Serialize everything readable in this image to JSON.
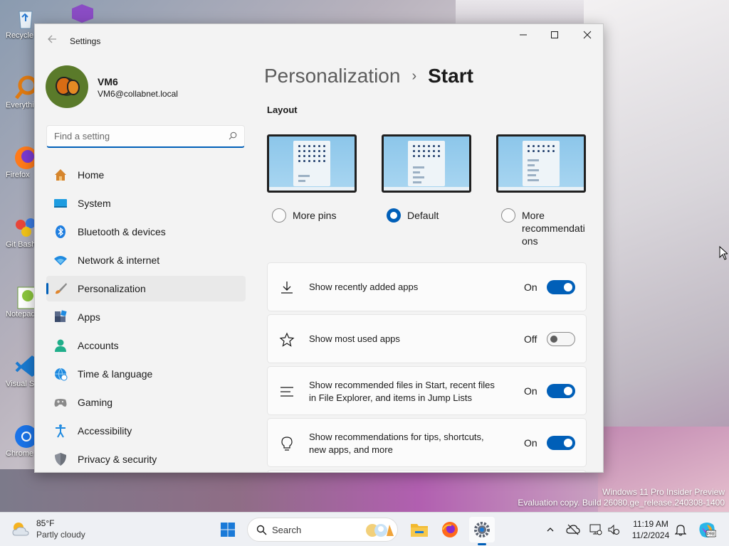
{
  "desktop": {
    "icons": [
      {
        "label": "Recycle Bin",
        "icon": "recycle-bin-icon"
      },
      {
        "label": "Everything",
        "icon": "everything-search-icon"
      },
      {
        "label": "Firefox",
        "icon": "firefox-icon"
      },
      {
        "label": "Git Bash",
        "icon": "git-bash-icon"
      },
      {
        "label": "Notepad++",
        "icon": "notepad-plus-plus-icon"
      },
      {
        "label": "Visual Studio Code",
        "icon": "vscode-icon"
      },
      {
        "label": "Chrome",
        "icon": "chrome-icon"
      }
    ],
    "watermark_line1": "Windows 11 Pro Insider Preview",
    "watermark_line2": "Evaluation copy. Build 26080.ge_release.240308-1400"
  },
  "window": {
    "title": "Settings",
    "controls": {
      "minimize": "—",
      "maximize": "☐",
      "close": "✕"
    }
  },
  "profile": {
    "name": "VM6",
    "email": "VM6@collabnet.local"
  },
  "search": {
    "placeholder": "Find a setting"
  },
  "sidebar": {
    "items": [
      {
        "label": "Home",
        "icon": "home-icon",
        "active": false
      },
      {
        "label": "System",
        "icon": "system-icon",
        "active": false
      },
      {
        "label": "Bluetooth & devices",
        "icon": "bluetooth-icon",
        "active": false
      },
      {
        "label": "Network & internet",
        "icon": "network-icon",
        "active": false
      },
      {
        "label": "Personalization",
        "icon": "brush-icon",
        "active": true
      },
      {
        "label": "Apps",
        "icon": "apps-icon",
        "active": false
      },
      {
        "label": "Accounts",
        "icon": "accounts-icon",
        "active": false
      },
      {
        "label": "Time & language",
        "icon": "time-language-icon",
        "active": false
      },
      {
        "label": "Gaming",
        "icon": "gaming-icon",
        "active": false
      },
      {
        "label": "Accessibility",
        "icon": "accessibility-icon",
        "active": false
      },
      {
        "label": "Privacy & security",
        "icon": "shield-icon",
        "active": false
      }
    ]
  },
  "main": {
    "breadcrumb_parent": "Personalization",
    "breadcrumb_sep": "›",
    "breadcrumb_current": "Start",
    "layout_section_title": "Layout",
    "layout_options": [
      {
        "label": "More pins",
        "selected": false
      },
      {
        "label": "Default",
        "selected": true
      },
      {
        "label_line1": "More",
        "label_line2": "recommendati",
        "label_line3": "ons",
        "selected": false
      }
    ],
    "settings": [
      {
        "label": "Show recently added apps",
        "state": "On",
        "on": true,
        "icon": "download-icon"
      },
      {
        "label": "Show most used apps",
        "state": "Off",
        "on": false,
        "icon": "star-icon"
      },
      {
        "label_line1": "Show recommended files in Start, recent files",
        "label_line2": "in File Explorer, and items in Jump Lists",
        "state": "On",
        "on": true,
        "icon": "list-icon"
      },
      {
        "label_line1": "Show recommendations for tips, shortcuts,",
        "label_line2": "new apps, and more",
        "state": "On",
        "on": true,
        "icon": "lightbulb-icon"
      }
    ]
  },
  "taskbar": {
    "weather_temp": "85°F",
    "weather_desc": "Partly cloudy",
    "search_label": "Search",
    "clock_time": "11:19 AM",
    "clock_date": "11/2/2024"
  },
  "colors": {
    "accent": "#005fb8",
    "window_bg": "#f3f3f3",
    "card_bg": "#fbfbfb"
  }
}
